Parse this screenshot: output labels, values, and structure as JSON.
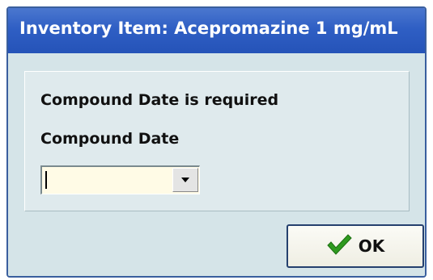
{
  "window": {
    "title": "Inventory Item: Acepromazine 1 mg/mL"
  },
  "message": {
    "required_text": "Compound Date is required",
    "field_label": "Compound Date"
  },
  "compound_date": {
    "value": "",
    "dropdown_icon": "chevron-down-icon"
  },
  "ok_button": {
    "label": "OK",
    "icon": "checkmark-icon",
    "icon_color": "#2e9a1f"
  },
  "colors": {
    "titlebar": "#2f5fc4",
    "dialog_bg": "#d5e4e8",
    "input_bg": "#fffbe6"
  }
}
